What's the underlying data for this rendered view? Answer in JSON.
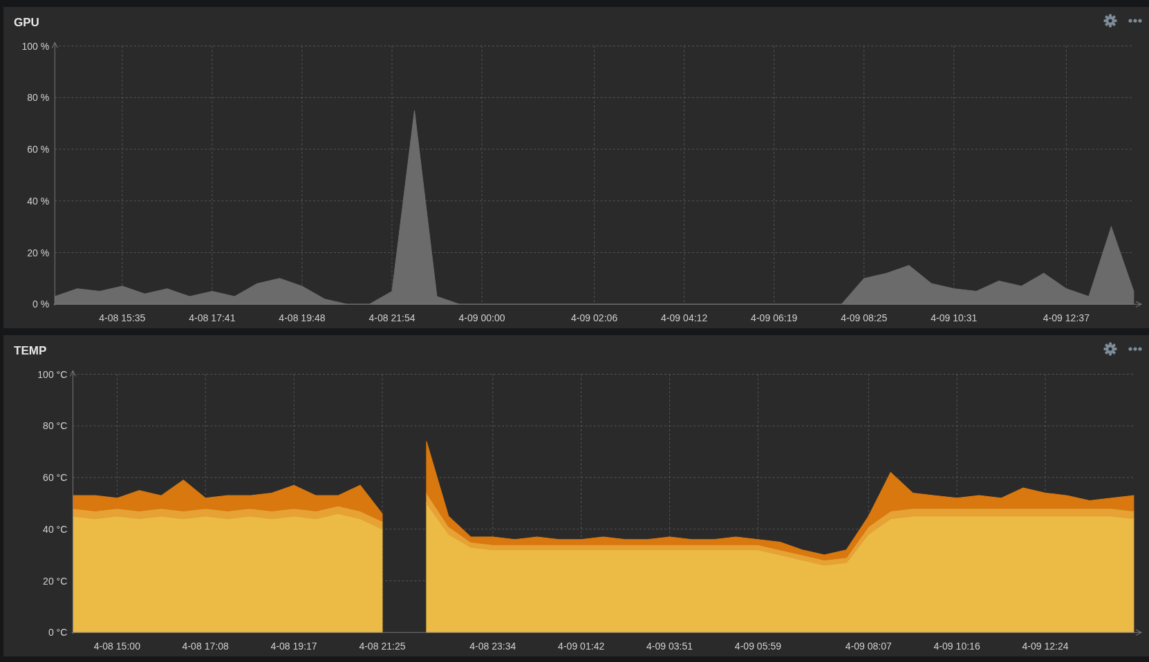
{
  "panels": [
    {
      "title": "GPU",
      "chart_data": {
        "type": "area",
        "stacked": false,
        "grid": true,
        "categories": [
          null,
          null,
          null,
          "4-08 15:35",
          null,
          null,
          null,
          "4-08 17:41",
          null,
          null,
          null,
          "4-08 19:48",
          null,
          null,
          null,
          "4-08 21:54",
          null,
          null,
          null,
          "4-09 00:00",
          null,
          null,
          null,
          null,
          "4-09 02:06",
          null,
          null,
          null,
          "4-09 04:12",
          null,
          null,
          null,
          "4-09 06:19",
          null,
          null,
          null,
          "4-09 08:25",
          null,
          null,
          null,
          "4-09 10:31",
          null,
          null,
          null,
          null,
          "4-09 12:37",
          null,
          null,
          null
        ],
        "series": [
          {
            "color": "#6b6b6b",
            "values": [
              3,
              6,
              5,
              7,
              4,
              6,
              3,
              5,
              3,
              8,
              10,
              7,
              2,
              0,
              0,
              5,
              75,
              3,
              0,
              0,
              0,
              0,
              0,
              0,
              0,
              0,
              0,
              0,
              0,
              0,
              0,
              0,
              0,
              0,
              0,
              0,
              10,
              12,
              15,
              8,
              6,
              5,
              9,
              7,
              12,
              6,
              3,
              30,
              5
            ]
          }
        ],
        "ylim": [
          0,
          100
        ],
        "yticks": [
          {
            "value": 0,
            "label": "0 %"
          },
          {
            "value": 20,
            "label": "20 %"
          },
          {
            "value": 40,
            "label": "40 %"
          },
          {
            "value": 60,
            "label": "60 %"
          },
          {
            "value": 80,
            "label": "80 %"
          },
          {
            "value": 100,
            "label": "100 %"
          }
        ]
      }
    },
    {
      "title": "TEMP",
      "chart_data": {
        "type": "area",
        "stacked": true,
        "grid": true,
        "categories": [
          null,
          null,
          "4-08 15:00",
          null,
          null,
          null,
          "4-08 17:08",
          null,
          null,
          null,
          "4-08 19:17",
          null,
          null,
          null,
          "4-08 21:25",
          null,
          null,
          null,
          null,
          "4-08 23:34",
          null,
          null,
          null,
          "4-09 01:42",
          null,
          null,
          null,
          "4-09 03:51",
          null,
          null,
          null,
          "4-09 05:59",
          null,
          null,
          null,
          null,
          "4-09 08:07",
          null,
          null,
          null,
          "4-09 10:16",
          null,
          null,
          null,
          "4-09 12:24",
          null,
          null,
          null,
          null
        ],
        "series": [
          {
            "color": "#ecbb45",
            "values": [
              45,
              44,
              45,
              44,
              45,
              44,
              45,
              44,
              45,
              44,
              45,
              44,
              46,
              44,
              40,
              null,
              50,
              38,
              33,
              32,
              32,
              32,
              32,
              32,
              32,
              32,
              32,
              32,
              32,
              32,
              32,
              32,
              30,
              28,
              26,
              27,
              38,
              44,
              45,
              45,
              45,
              45,
              45,
              45,
              45,
              45,
              45,
              45,
              44
            ]
          },
          {
            "color": "#e6a235",
            "values": [
              3,
              3,
              3,
              3,
              3,
              3,
              3,
              3,
              3,
              3,
              3,
              3,
              3,
              3,
              3,
              null,
              4,
              3,
              2,
              2,
              2,
              2,
              2,
              2,
              2,
              2,
              2,
              2,
              2,
              2,
              2,
              2,
              2,
              2,
              2,
              2,
              3,
              3,
              3,
              3,
              3,
              3,
              3,
              3,
              3,
              3,
              3,
              3,
              3
            ]
          },
          {
            "color": "#d9780f",
            "values": [
              5,
              6,
              4,
              8,
              5,
              12,
              4,
              6,
              5,
              7,
              9,
              6,
              4,
              10,
              3,
              null,
              20,
              4,
              2,
              3,
              2,
              3,
              2,
              2,
              3,
              2,
              2,
              3,
              2,
              2,
              3,
              2,
              3,
              2,
              2,
              3,
              4,
              15,
              6,
              5,
              4,
              5,
              4,
              8,
              6,
              5,
              3,
              4,
              6
            ]
          }
        ],
        "ylim": [
          0,
          100
        ],
        "yticks": [
          {
            "value": 0,
            "label": "0 °C"
          },
          {
            "value": 20,
            "label": "20 °C"
          },
          {
            "value": 40,
            "label": "40 °C"
          },
          {
            "value": 60,
            "label": "60 °C"
          },
          {
            "value": 80,
            "label": "80 °C"
          },
          {
            "value": 100,
            "label": "100 °C"
          }
        ]
      }
    }
  ]
}
